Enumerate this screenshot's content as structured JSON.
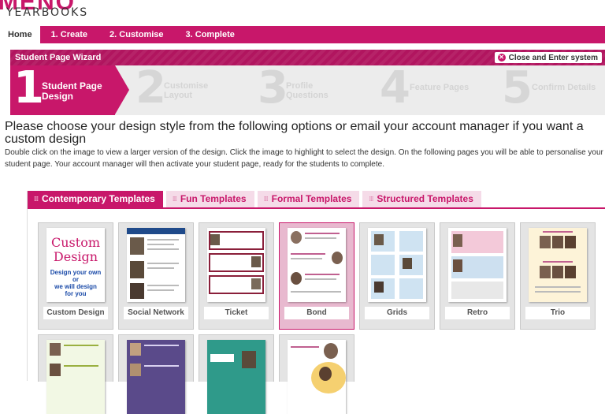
{
  "logo": {
    "main": "MENO",
    "sub": "YEARBOOKS"
  },
  "nav": {
    "items": [
      "Home",
      "1. Create",
      "2. Customise",
      "3. Complete"
    ]
  },
  "wizard": {
    "title": "Student Page Wizard",
    "close_label": "Close and Enter system",
    "steps": [
      {
        "num": "1",
        "label_line1": "Student Page",
        "label_line2": "Design"
      },
      {
        "num": "2",
        "label_line1": "Customise",
        "label_line2": "Layout"
      },
      {
        "num": "3",
        "label_line1": "Profile",
        "label_line2": "Questions"
      },
      {
        "num": "4",
        "label_line1": "Feature Pages",
        "label_line2": ""
      },
      {
        "num": "5",
        "label_line1": "Confirm Details",
        "label_line2": ""
      }
    ]
  },
  "main": {
    "heading": "Please choose your design style from the following options or email your account manager if you want a custom design",
    "description": "Double click on the image to view a larger version of the design. Click the image to highlight to select the design. On the following pages you will be able to personalise your student page. Your account manager will then activate your student page, ready for the students to complete."
  },
  "tabs": [
    "Contemporary Templates",
    "Fun Templates",
    "Formal Templates",
    "Structured Templates"
  ],
  "templates": [
    "Custom Design",
    "Social Network",
    "Ticket",
    "Bond",
    "Grids",
    "Retro",
    "Trio"
  ],
  "custom_thumb": {
    "line1": "Custom",
    "line2": "Design",
    "line3": "Design your own",
    "line4": "or",
    "line5": "we will design",
    "line6": "for you"
  },
  "selected_template": "Bond",
  "colors": {
    "accent": "#c8176a",
    "accent_light": "#f5dbe8",
    "selected_bg": "#e8b9cf"
  }
}
